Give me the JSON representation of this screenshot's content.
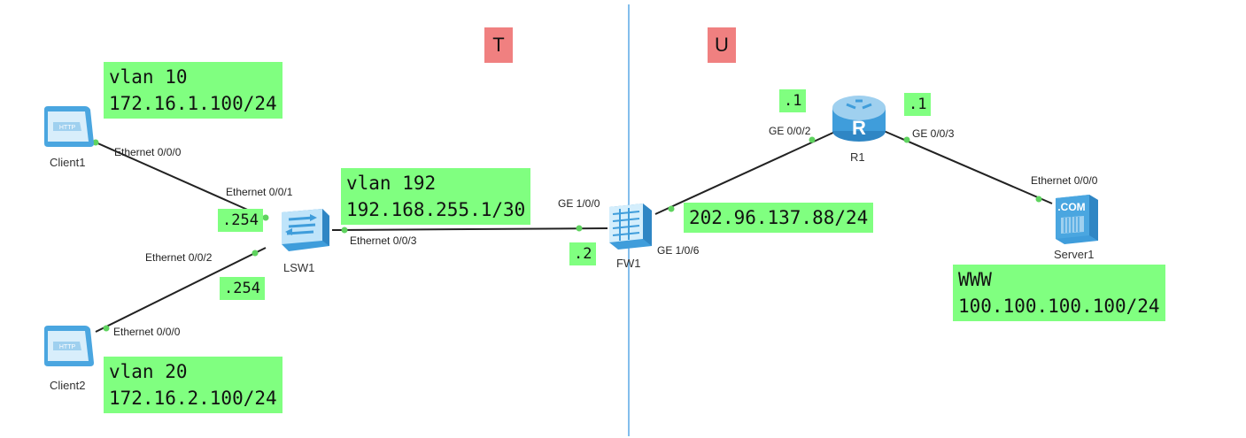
{
  "zones": {
    "left": "T",
    "right": "U",
    "divider_color": "#5aa9e6"
  },
  "devices": {
    "client1": "Client1",
    "client2": "Client2",
    "lsw1": "LSW1",
    "fw1": "FW1",
    "r1": "R1",
    "server1": "Server1"
  },
  "ports": {
    "client1_eth": "Ethernet 0/0/0",
    "lsw1_eth1": "Ethernet 0/0/1",
    "lsw1_eth2": "Ethernet 0/0/2",
    "client2_eth": "Ethernet 0/0/0",
    "lsw1_eth3": "Ethernet 0/0/3",
    "fw1_ge100": "GE 1/0/0",
    "fw1_ge106": "GE 1/0/6",
    "r1_ge002": "GE 0/0/2",
    "r1_ge003": "GE 0/0/3",
    "server1_eth": "Ethernet 0/0/0"
  },
  "labels": {
    "vlan10_name": "vlan 10",
    "vlan10_ip": "172.16.1.100/24",
    "vlan20_name": "vlan 20",
    "vlan20_ip": "172.16.2.100/24",
    "vlan192_name": "vlan 192",
    "vlan192_ip": "192.168.255.1/30",
    "lsw_gw1": ".254",
    "lsw_gw2": ".254",
    "fw_inside": ".2",
    "fw_outside": "202.96.137.88/24",
    "r1_left": ".1",
    "r1_right": ".1",
    "www_name": "WWW",
    "www_ip": "100.100.100.100/24"
  },
  "colors": {
    "label_bg": "#80ff80",
    "zone_bg": "#f08080",
    "link": "#222222",
    "port_dot": "#5fd35f"
  }
}
